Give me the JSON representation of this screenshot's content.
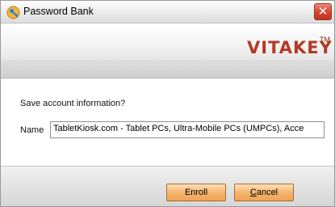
{
  "window": {
    "title": "Password Bank",
    "close_glyph": "✕"
  },
  "banner": {
    "brand": "VITAKEY",
    "trademark": "TM"
  },
  "dialog": {
    "prompt": "Save account information?",
    "name_label": "Name",
    "name_value": "TabletKiosk.com - Tablet PCs, Ultra-Mobile PCs (UMPCs), Acce"
  },
  "buttons": {
    "enroll": "Enroll",
    "cancel_mnemonic": "C",
    "cancel_rest": "ancel"
  },
  "colors": {
    "brand": "#b23a25",
    "button_fill": "#f5b570",
    "close_button": "#d4432d"
  }
}
